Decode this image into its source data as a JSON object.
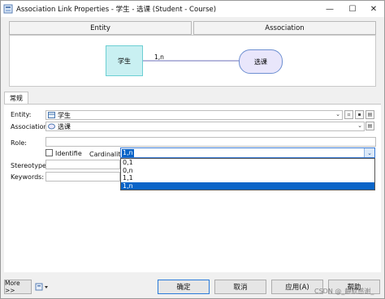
{
  "window": {
    "title": "Association Link Properties - 学生 - 选课 (Student - Course)",
    "controls": {
      "minimize": "—",
      "maximize": "☐",
      "close": "✕"
    }
  },
  "tabs": [
    {
      "label": "Entity"
    },
    {
      "label": "Association"
    }
  ],
  "diagram": {
    "entity": "学生",
    "association": "选课",
    "cardinality_label": "1,n"
  },
  "section_tab": "常规",
  "form": {
    "entity_label": "Entity:",
    "entity_value": "学生",
    "association_label": "Association:",
    "association_value": "选课",
    "role_label": "Role:",
    "identifier_label": "Identifie",
    "cardinality_label": "Cardinality:",
    "cardinality_value": "1,n",
    "stereotype_label": "Stereotype:",
    "keywords_label": "Keywords:"
  },
  "cardinality_options": [
    "0,1",
    "0,n",
    "1,1",
    "1,n"
  ],
  "buttons": {
    "more": "More >>",
    "ok": "确定",
    "cancel": "取消",
    "apply": "应用(A)",
    "help": "帮助"
  },
  "watermark": "CSDN @_静默感谢_",
  "colors": {
    "selection": "#0a64c8",
    "entity_fill": "#c9f0f2",
    "association_fill": "#e9e6fb",
    "primary_border": "#2a7ad9"
  }
}
